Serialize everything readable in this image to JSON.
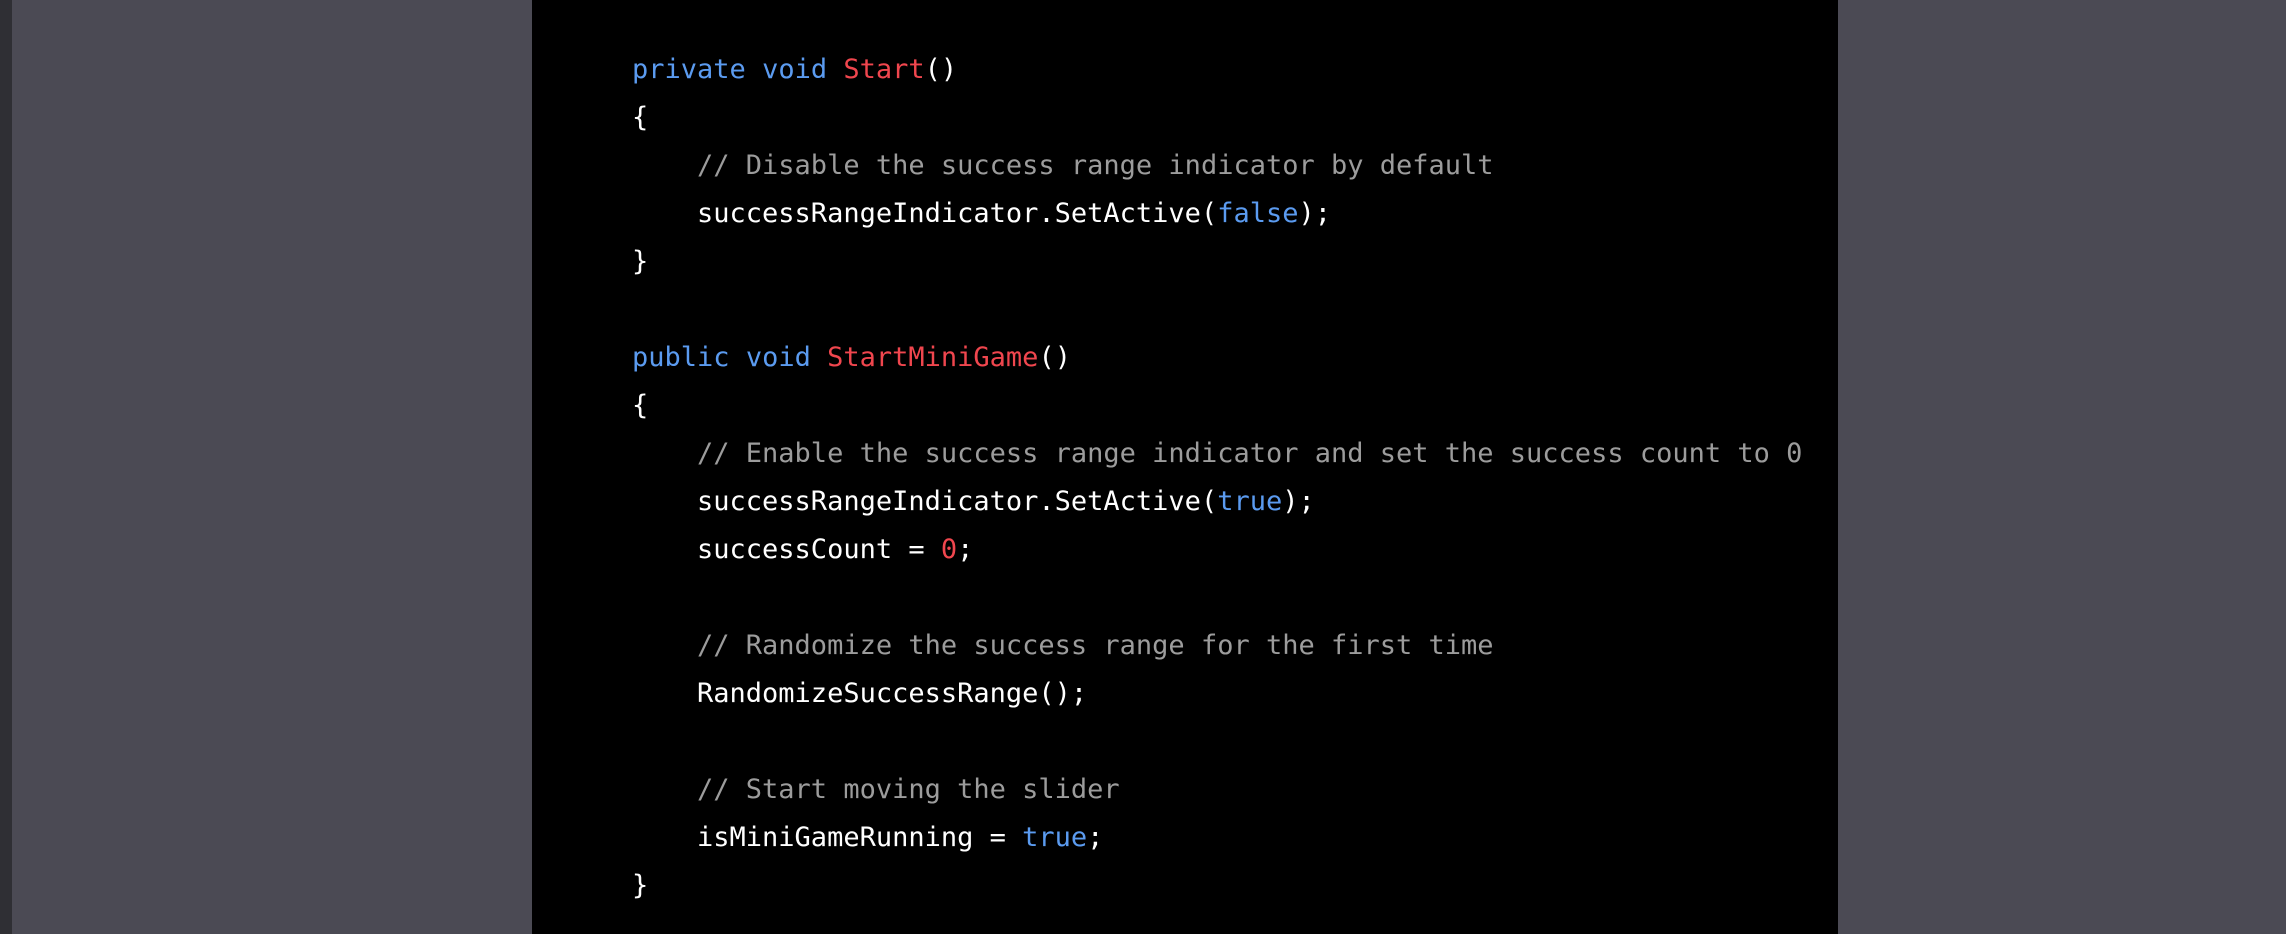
{
  "colors": {
    "page_background": "#4b4a54",
    "left_edge": "#2f2f34",
    "code_background": "#000000",
    "plain_text": "#ffffff",
    "keyword": "#5b9bf0",
    "function_name": "#f0464e",
    "number": "#f0464e",
    "comment": "#9c9c9c"
  },
  "code_block": {
    "language": "csharp",
    "lines": [
      [
        {
          "text": "private",
          "type": "keyword"
        },
        {
          "text": " ",
          "type": "plain"
        },
        {
          "text": "void",
          "type": "keyword"
        },
        {
          "text": " ",
          "type": "plain"
        },
        {
          "text": "Start",
          "type": "func"
        },
        {
          "text": "()",
          "type": "plain"
        }
      ],
      [
        {
          "text": "{",
          "type": "plain"
        }
      ],
      [
        {
          "text": "    // Disable the success range indicator by default",
          "type": "comment"
        }
      ],
      [
        {
          "text": "    successRangeIndicator.SetActive(",
          "type": "plain"
        },
        {
          "text": "false",
          "type": "keyword"
        },
        {
          "text": ");",
          "type": "plain"
        }
      ],
      [
        {
          "text": "}",
          "type": "plain"
        }
      ],
      [],
      [
        {
          "text": "public",
          "type": "keyword"
        },
        {
          "text": " ",
          "type": "plain"
        },
        {
          "text": "void",
          "type": "keyword"
        },
        {
          "text": " ",
          "type": "plain"
        },
        {
          "text": "StartMiniGame",
          "type": "func"
        },
        {
          "text": "()",
          "type": "plain"
        }
      ],
      [
        {
          "text": "{",
          "type": "plain"
        }
      ],
      [
        {
          "text": "    // Enable the success range indicator and set the success count to 0",
          "type": "comment"
        }
      ],
      [
        {
          "text": "    successRangeIndicator.SetActive(",
          "type": "plain"
        },
        {
          "text": "true",
          "type": "keyword"
        },
        {
          "text": ");",
          "type": "plain"
        }
      ],
      [
        {
          "text": "    successCount = ",
          "type": "plain"
        },
        {
          "text": "0",
          "type": "number"
        },
        {
          "text": ";",
          "type": "plain"
        }
      ],
      [],
      [
        {
          "text": "    // Randomize the success range for the first time",
          "type": "comment"
        }
      ],
      [
        {
          "text": "    RandomizeSuccessRange();",
          "type": "plain"
        }
      ],
      [],
      [
        {
          "text": "    // Start moving the slider",
          "type": "comment"
        }
      ],
      [
        {
          "text": "    isMiniGameRunning = ",
          "type": "plain"
        },
        {
          "text": "true",
          "type": "keyword"
        },
        {
          "text": ";",
          "type": "plain"
        }
      ],
      [
        {
          "text": "}",
          "type": "plain"
        }
      ]
    ]
  }
}
